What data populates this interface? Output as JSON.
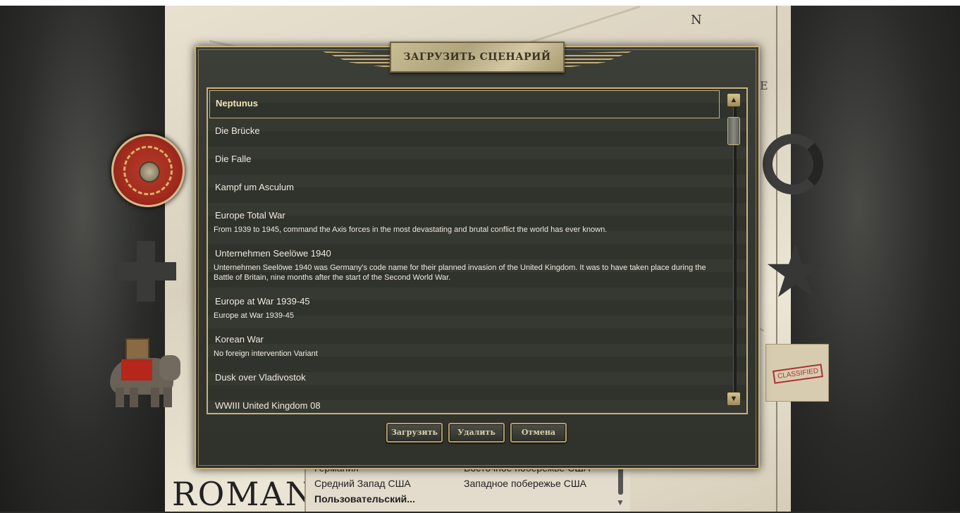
{
  "background": {
    "compass_letter": "N",
    "map_letter_e": "E",
    "banner_text": "ROMAN",
    "under_list": {
      "rows": [
        {
          "left": "Германия",
          "right": "Восточное побережье США"
        },
        {
          "left": "Средний Запад США",
          "right": "Западное побережье США"
        }
      ],
      "custom_item": "Пользовательский..."
    },
    "classified_stamp": "CLASSIFIED"
  },
  "dialog": {
    "title": "ЗАГРУЗИТЬ СЦЕНАРИЙ",
    "scenarios": [
      {
        "name": "Neptunus",
        "description": "",
        "selected": true
      },
      {
        "name": "Die Brücke",
        "description": ""
      },
      {
        "name": "Die Falle",
        "description": ""
      },
      {
        "name": "Kampf um Asculum",
        "description": ""
      },
      {
        "name": "Europe Total War",
        "description": "From 1939 to 1945, command the Axis forces in the most devastating and brutal conflict the world has ever known."
      },
      {
        "name": "Unternehmen Seelöwe 1940",
        "description": "Unternehmen Seelöwe 1940 was Germany's code name for their planned invasion of the United Kingdom. It was to have taken place during the Battle of Britain, nine months after the start of the Second World War."
      },
      {
        "name": "Europe at War 1939-45",
        "description": "Europe at War 1939-45"
      },
      {
        "name": "Korean War",
        "description": "No foreign intervention Variant"
      },
      {
        "name": "Dusk over Vladivostok",
        "description": ""
      },
      {
        "name": "WWIII United Kingdom 08",
        "description": ""
      }
    ],
    "buttons": {
      "load": "Загрузить",
      "delete": "Удалить",
      "cancel": "Отмена"
    }
  },
  "colors": {
    "accent_gold": "#c8b27a",
    "panel": "#34362f",
    "text": "#f0ebdf"
  }
}
